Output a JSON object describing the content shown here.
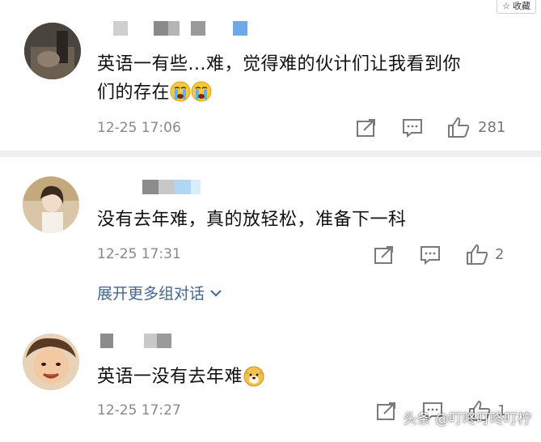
{
  "header": {
    "favorite_label": "收藏"
  },
  "comments": [
    {
      "text_line1": "英语一有些...难，觉得难的伙计们让我看到你",
      "text_line2": "们的存在",
      "time": "12-25 17:06",
      "likes": "281"
    },
    {
      "text": "没有去年难，真的放轻松，准备下一科",
      "time": "12-25 17:31",
      "likes": "2"
    },
    {
      "text": "英语一没有去年难",
      "time": "12-25 17:27",
      "likes": "1"
    }
  ],
  "expand_label": "展开更多组对话",
  "watermark": "头条 @叮咚叮咚叮柠",
  "icons": {
    "favorite": "star-icon",
    "share": "share-icon",
    "reply": "comment-icon",
    "like": "thumbs-up-icon",
    "expand": "chevron-down-icon"
  }
}
